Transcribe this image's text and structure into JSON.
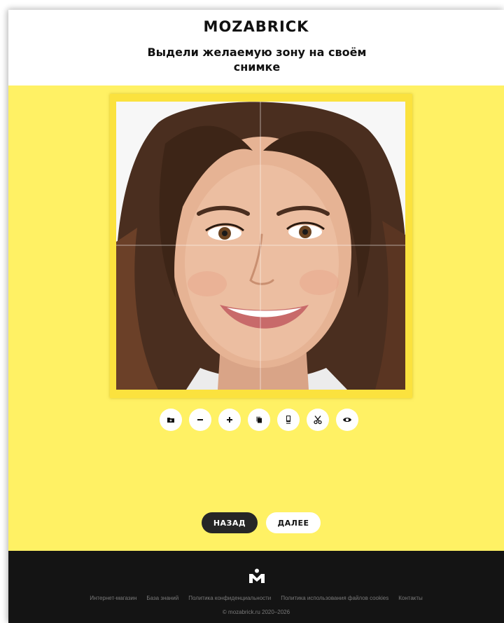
{
  "brand": {
    "logo_text": "MOZABRICK"
  },
  "header": {
    "title": "Выдели желаемую зону на своём снимке"
  },
  "editor": {
    "image_alt": "Портрет улыбающейся женщины",
    "toolbar": [
      {
        "name": "upload-photo-button",
        "icon": "folder-plus-icon"
      },
      {
        "name": "zoom-out-button",
        "icon": "minus-icon"
      },
      {
        "name": "zoom-in-button",
        "icon": "plus-icon"
      },
      {
        "name": "duplicate-button",
        "icon": "copy-icon"
      },
      {
        "name": "portrait-frame-button",
        "icon": "phone-frame-icon"
      },
      {
        "name": "crop-button",
        "icon": "scissors-icon"
      },
      {
        "name": "preview-button",
        "icon": "eye-icon"
      }
    ]
  },
  "nav": {
    "back_label": "НАЗАД",
    "next_label": "ДАЛЕЕ"
  },
  "footer": {
    "links": [
      "Интернет-магазин",
      "База знаний",
      "Политика конфиденциальности",
      "Политика использования файлов cookies",
      "Контакты"
    ],
    "copyright": "© mozabrick.ru 2020–2026"
  },
  "colors": {
    "page_yellow": "#fff164",
    "frame_yellow": "#fbe23e",
    "footer_bg": "#141414",
    "back_button": "#262626"
  }
}
